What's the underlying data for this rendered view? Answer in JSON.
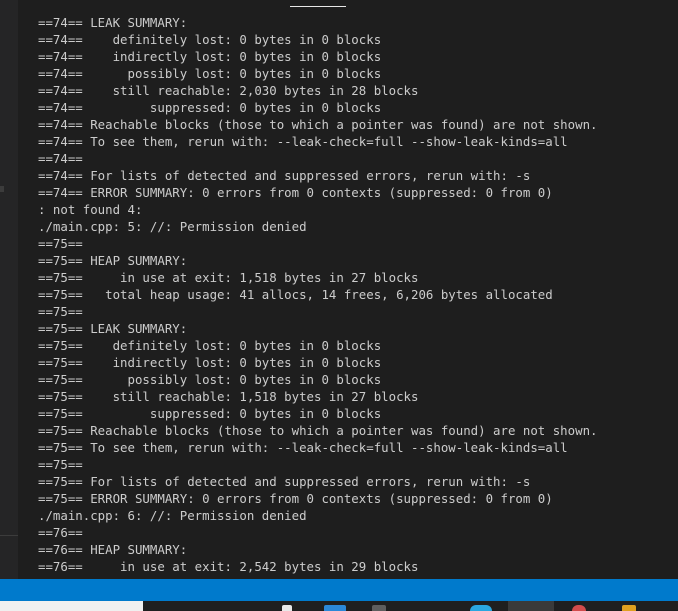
{
  "terminal": {
    "lines": [
      "==74== LEAK SUMMARY:",
      "==74==    definitely lost: 0 bytes in 0 blocks",
      "==74==    indirectly lost: 0 bytes in 0 blocks",
      "==74==      possibly lost: 0 bytes in 0 blocks",
      "==74==    still reachable: 2,030 bytes in 28 blocks",
      "==74==         suppressed: 0 bytes in 0 blocks",
      "==74== Reachable blocks (those to which a pointer was found) are not shown.",
      "==74== To see them, rerun with: --leak-check=full --show-leak-kinds=all",
      "==74==",
      "==74== For lists of detected and suppressed errors, rerun with: -s",
      "==74== ERROR SUMMARY: 0 errors from 0 contexts (suppressed: 0 from 0)",
      ": not found 4:",
      "./main.cpp: 5: //: Permission denied",
      "==75==",
      "==75== HEAP SUMMARY:",
      "==75==     in use at exit: 1,518 bytes in 27 blocks",
      "==75==   total heap usage: 41 allocs, 14 frees, 6,206 bytes allocated",
      "==75==",
      "==75== LEAK SUMMARY:",
      "==75==    definitely lost: 0 bytes in 0 blocks",
      "==75==    indirectly lost: 0 bytes in 0 blocks",
      "==75==      possibly lost: 0 bytes in 0 blocks",
      "==75==    still reachable: 1,518 bytes in 27 blocks",
      "==75==         suppressed: 0 bytes in 0 blocks",
      "==75== Reachable blocks (those to which a pointer was found) are not shown.",
      "==75== To see them, rerun with: --leak-check=full --show-leak-kinds=all",
      "==75==",
      "==75== For lists of detected and suppressed errors, rerun with: -s",
      "==75== ERROR SUMMARY: 0 errors from 0 contexts (suppressed: 0 from 0)",
      "./main.cpp: 6: //: Permission denied",
      "==76==",
      "==76== HEAP SUMMARY:",
      "==76==     in use at exit: 2,542 bytes in 29 blocks"
    ]
  },
  "colors": {
    "background": "#1e1e1e",
    "text": "#cccccc",
    "status_bar": "#007acc",
    "taskbar": "#1f1f1f"
  },
  "taskbar_icons": [
    "app-icon",
    "app-icon",
    "app-icon",
    "app-icon",
    "app-icon",
    "app-icon"
  ]
}
